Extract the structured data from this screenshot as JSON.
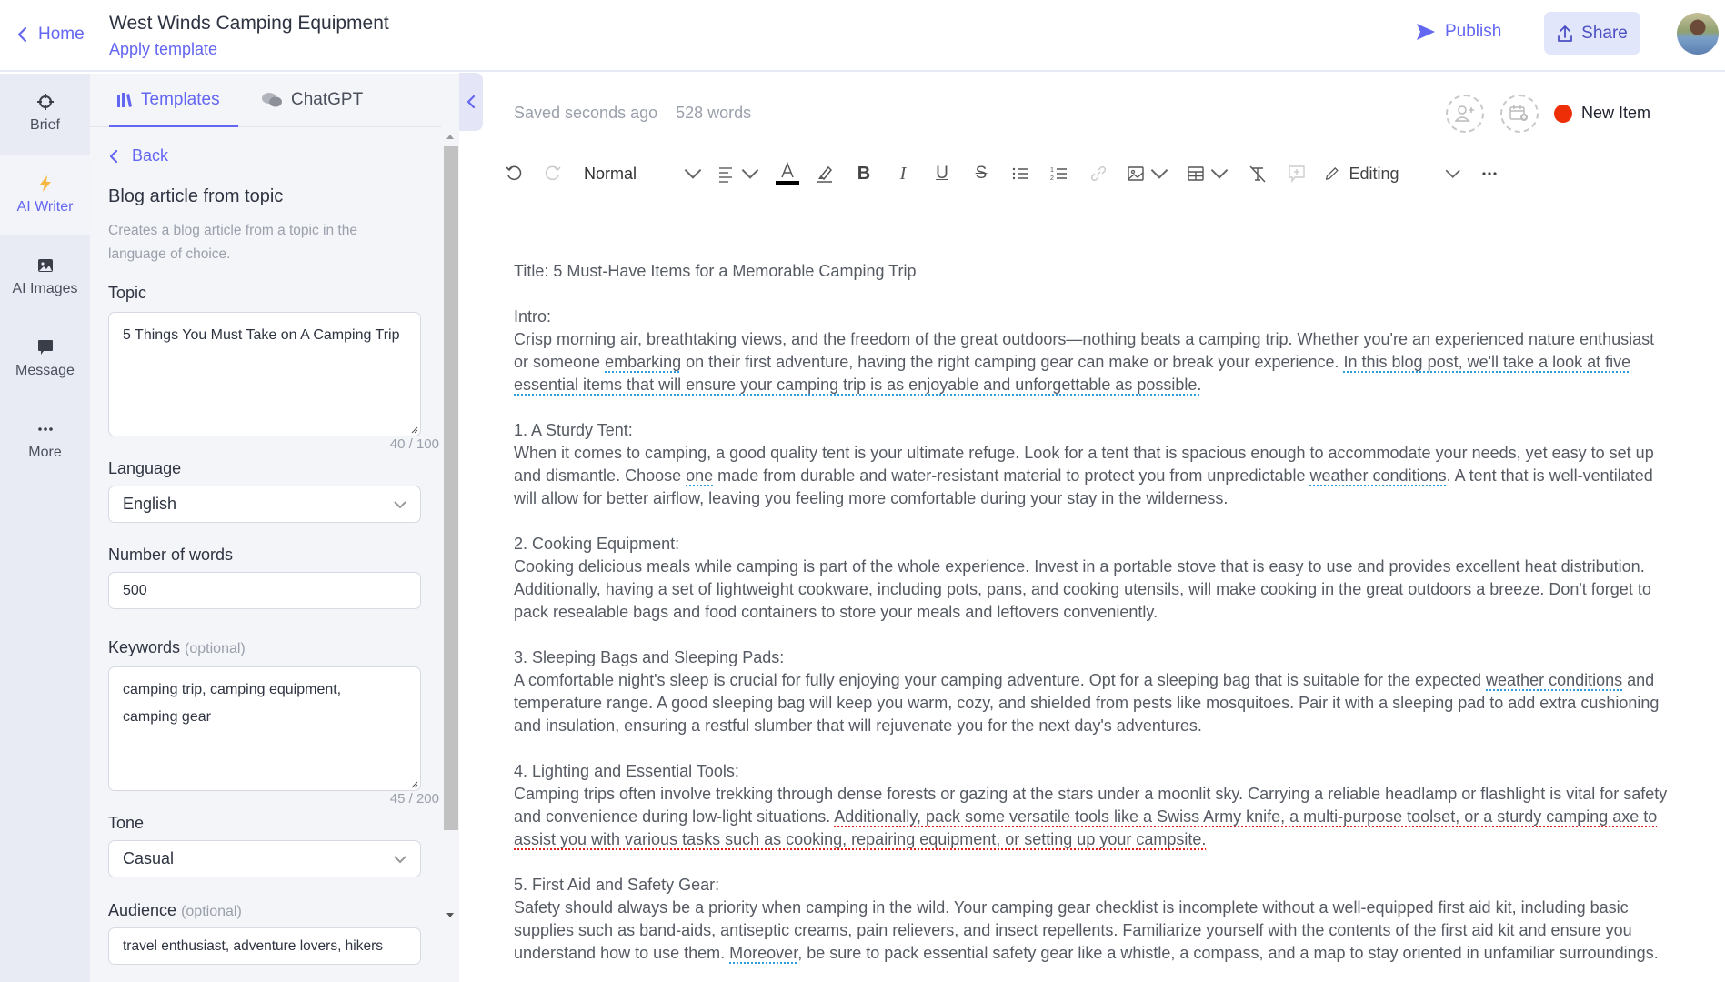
{
  "header": {
    "home_label": "Home",
    "doc_title": "West Winds Camping Equipment",
    "apply_template": "Apply template",
    "publish_label": "Publish",
    "share_label": "Share"
  },
  "rail": {
    "items": [
      {
        "label": "Brief",
        "icon": "crosshair-icon"
      },
      {
        "label": "AI Writer",
        "icon": "lightning-icon",
        "active": true
      },
      {
        "label": "AI Images",
        "icon": "image-icon"
      },
      {
        "label": "Message",
        "icon": "chat-bubble-icon"
      },
      {
        "label": "More",
        "icon": "more-dots-icon"
      }
    ]
  },
  "panel": {
    "tabs": [
      {
        "label": "Templates",
        "active": true
      },
      {
        "label": "ChatGPT",
        "active": false
      }
    ],
    "back_label": "Back",
    "template_title": "Blog article from topic",
    "template_desc": "Creates a blog article from a topic in the language of choice.",
    "fields": {
      "topic": {
        "label": "Topic",
        "value": "5 Things You Must Take on A Camping Trip",
        "counter": "40 / 100"
      },
      "language": {
        "label": "Language",
        "value": "English"
      },
      "words": {
        "label": "Number of words",
        "value": "500"
      },
      "keywords": {
        "label": "Keywords",
        "optional": "(optional)",
        "value": "camping trip, camping equipment, camping gear",
        "counter": "45 / 200"
      },
      "tone": {
        "label": "Tone",
        "value": "Casual"
      },
      "audience": {
        "label": "Audience",
        "optional": "(optional)",
        "value": "travel enthusiast, adventure lovers, hikers"
      }
    }
  },
  "editor": {
    "saved_status": "Saved seconds ago",
    "word_count": "528 words",
    "new_item_label": "New Item",
    "status_color": "#ee2e07",
    "toolbar": {
      "style_select": "Normal",
      "mode_label": "Editing"
    },
    "document": {
      "title": "Title: 5 Must-Have Items for a Memorable Camping Trip",
      "intro_heading": "Intro:",
      "intro": [
        {
          "t": "Crisp morning air, breathtaking views, and the freedom of the great outdoors—nothing beats a camping trip. Whether you're an experienced nature enthusiast or someone "
        },
        {
          "t": "embarking",
          "u": "blue"
        },
        {
          "t": " on their first adventure, having the right camping gear can make or break your experience. "
        },
        {
          "t": "In this blog post, we'll take a look at five essential items that will ensure your camping trip is as enjoyable and unforgettable as possible.",
          "u": "blue"
        }
      ],
      "sections": [
        {
          "heading": "1. A Sturdy Tent:",
          "body": [
            {
              "t": "When it comes to camping, a good quality tent is your ultimate refuge. Look for a tent that is spacious enough to accommodate your needs, yet easy to set up and dismantle. Choose "
            },
            {
              "t": "one",
              "u": "blue"
            },
            {
              "t": " made from durable and water-resistant material to protect you from unpredictable "
            },
            {
              "t": "weather conditions",
              "u": "blue"
            },
            {
              "t": ". A tent that is well-ventilated will allow for better airflow, leaving you feeling more comfortable during your stay in the wilderness."
            }
          ]
        },
        {
          "heading": "2. Cooking Equipment:",
          "body": [
            {
              "t": "Cooking delicious meals while camping is part of the whole experience. Invest in a portable stove that is easy to use and provides excellent heat distribution. Additionally, having a set of lightweight cookware, including pots, pans, and cooking utensils, will make cooking in the great outdoors a breeze. Don't forget to pack resealable bags and food containers to store your meals and leftovers conveniently."
            }
          ]
        },
        {
          "heading": "3. Sleeping Bags and Sleeping Pads:",
          "body": [
            {
              "t": "A comfortable night's sleep is crucial for fully enjoying your camping adventure. Opt for a sleeping bag that is suitable for the expected "
            },
            {
              "t": "weather conditions",
              "u": "blue"
            },
            {
              "t": " and temperature range. A good sleeping bag will keep you warm, cozy, and shielded from pests like mosquitoes. Pair it with a sleeping pad to add extra cushioning and insulation, ensuring a restful slumber that will rejuvenate you for the next day's adventures."
            }
          ]
        },
        {
          "heading": "4. Lighting and Essential Tools:",
          "body": [
            {
              "t": "Camping trips often involve trekking through dense forests or gazing at the stars under a moonlit sky. Carrying a reliable headlamp or flashlight is vital for safety and convenience during low-light situations. "
            },
            {
              "t": "Additionally, pack some versatile tools like a Swiss Army knife, a multi-purpose toolset, or a sturdy camping axe to assist you with various tasks such as cooking, repairing equipment, or setting up your campsite.",
              "u": "red"
            }
          ]
        },
        {
          "heading": "5. First Aid and Safety Gear:",
          "body": [
            {
              "t": "Safety should always be a priority when camping in the wild. Your camping gear checklist is incomplete without a well-equipped first aid kit, including basic supplies such as band-aids, antiseptic creams, pain relievers, and insect repellents. Familiarize yourself with the contents of the first aid kit and ensure you understand how to use them. "
            },
            {
              "t": "Moreover",
              "u": "blue"
            },
            {
              "t": ", be sure to pack essential safety gear like a whistle, a compass, and a map to stay oriented in unfamiliar surroundings."
            }
          ]
        }
      ]
    }
  },
  "colors": {
    "accent": "#6366f1",
    "share_bg": "#e2e6fb",
    "rail_bg": "#e9ebf4",
    "panel_bg": "#f4f5f9",
    "grammar_blue": "#2d9cdb",
    "spelling_red": "#e0201a"
  }
}
